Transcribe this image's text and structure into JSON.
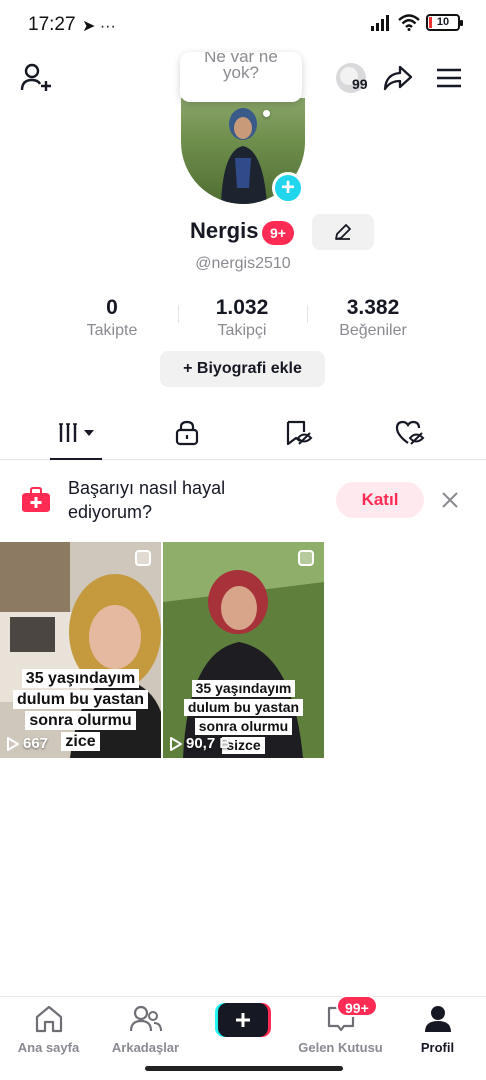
{
  "status_bar": {
    "time": "17:27",
    "left_icons": "➤ ···",
    "battery": "10"
  },
  "bubble": {
    "line1": "Ne var ne",
    "line2": "yok?"
  },
  "header": {
    "coins": "99"
  },
  "profile": {
    "name": "Nergis",
    "name_badge": "9+",
    "handle": "@nergis2510"
  },
  "stats": [
    {
      "value": "0",
      "label": "Takipte"
    },
    {
      "value": "1.032",
      "label": "Takipçi"
    },
    {
      "value": "3.382",
      "label": "Beğeniler"
    }
  ],
  "bio_button": "+ Biyografi ekle",
  "challenge": {
    "text": "Başarıyı nasıl hayal ediyorum?",
    "join": "Katıl"
  },
  "videos": [
    {
      "caption": [
        "35 yaşındayım",
        "dulum bu yastan",
        "sonra olurmu",
        "zice"
      ],
      "views": "667"
    },
    {
      "caption": [
        "35 yaşındayım",
        "dulum bu yastan",
        "sonra olurmu",
        "sizce"
      ],
      "views": "90,7 B"
    }
  ],
  "nav": {
    "home": "Ana sayfa",
    "friends": "Arkadaşlar",
    "inbox": "Gelen Kutusu",
    "inbox_badge": "99+",
    "profile": "Profil"
  },
  "colors": {
    "accent": "#fe2c55",
    "teal": "#20d5ec"
  }
}
